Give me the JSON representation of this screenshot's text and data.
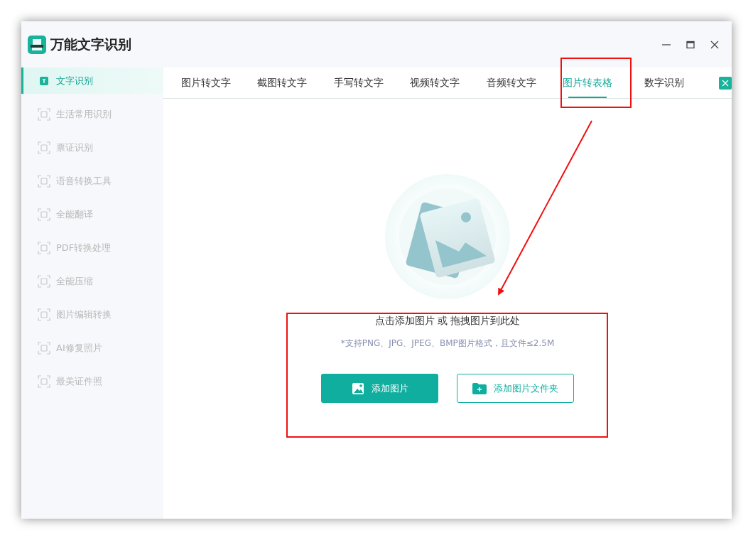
{
  "app": {
    "title": "万能文字识别"
  },
  "sidebar": {
    "items": [
      {
        "label": "文字识别",
        "selected": true
      },
      {
        "label": "生活常用识别",
        "selected": false
      },
      {
        "label": "票证识别",
        "selected": false
      },
      {
        "label": "语音转换工具",
        "selected": false
      },
      {
        "label": "全能翻译",
        "selected": false
      },
      {
        "label": "PDF转换处理",
        "selected": false
      },
      {
        "label": "全能压缩",
        "selected": false
      },
      {
        "label": "图片编辑转换",
        "selected": false
      },
      {
        "label": "AI修复照片",
        "selected": false
      },
      {
        "label": "最美证件照",
        "selected": false
      }
    ]
  },
  "tabs": [
    {
      "label": "图片转文字",
      "selected": false
    },
    {
      "label": "截图转文字",
      "selected": false
    },
    {
      "label": "手写转文字",
      "selected": false
    },
    {
      "label": "视频转文字",
      "selected": false
    },
    {
      "label": "音频转文字",
      "selected": false
    },
    {
      "label": "图片转表格",
      "selected": true
    },
    {
      "label": "数字识别",
      "selected": false
    }
  ],
  "drop_zone": {
    "prompt": "点击添加图片 或 拖拽图片到此处",
    "hint": "*支持PNG、JPG、JPEG、BMP图片格式，且文件≤2.5M",
    "buttons": [
      {
        "label": "添加图片",
        "kind": "primary"
      },
      {
        "label": "添加图片文件夹",
        "kind": "outline"
      }
    ]
  }
}
